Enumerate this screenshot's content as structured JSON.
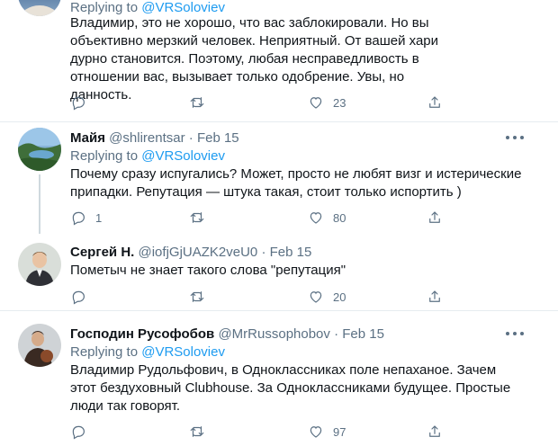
{
  "tweets": [
    {
      "replying_prefix": "Replying to",
      "replying_handle": "@VRSoloviev",
      "text": "Владимир, это не хорошо, что вас заблокировали. Но вы объективно мерзкий человек. Неприятный. От вашей хари дурно становится. Поэтому, любая несправедливость в отношении вас, вызывает только одобрение. Увы, но данность.",
      "likes": "23",
      "icons": [
        "comment-icon",
        "retweet-icon",
        "heart-icon",
        "share-icon"
      ]
    },
    {
      "name": "Майя",
      "handle": "@shlirentsar",
      "dot": "·",
      "date": "Feb 15",
      "replying_prefix": "Replying to",
      "replying_handle": "@VRSoloviev",
      "text": "Почему сразу испугались? Может, просто не любят визг и истерические припадки. Репутация — штука такая, стоит только испортить )",
      "replies": "1",
      "likes": "80"
    },
    {
      "name": "Сергей Н.",
      "handle": "@iofjGjUAZK2veU0",
      "dot": "·",
      "date": "Feb 15",
      "text": "Пометыч не знает такого слова \"репутация\"",
      "likes": "20"
    },
    {
      "name": "Господин Русофобов",
      "handle": "@MrRussophobov",
      "dot": "·",
      "date": "Feb 15",
      "replying_prefix": "Replying to",
      "replying_handle": "@VRSoloviev",
      "text": "Владимир Рудольфович, в Одноклассниках поле непаханое. Зачем этот бездуховный Clubhouse. За Одноклассниками будущее. Простые люди так говорят.",
      "likes": "97"
    }
  ],
  "colors": {
    "link": "#1d9bf0",
    "secondary": "#5b7083",
    "separator": "#e6ecf0"
  }
}
